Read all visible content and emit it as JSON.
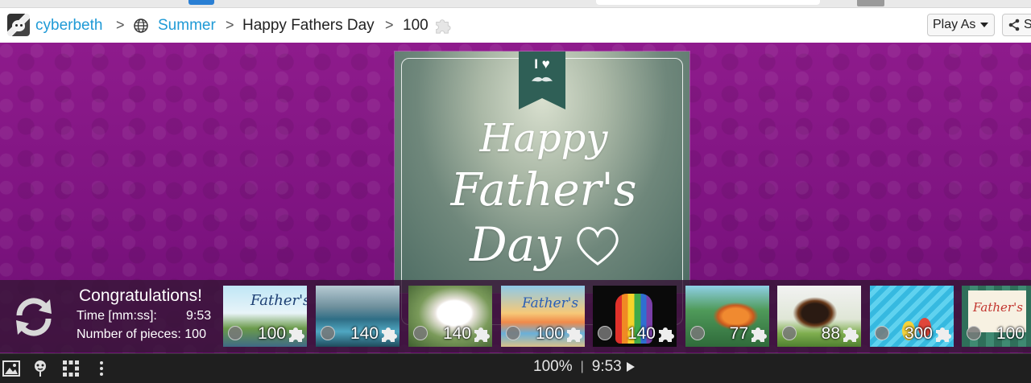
{
  "header": {
    "user": "cyberbeth",
    "category": "Summer",
    "puzzle_title": "Happy Fathers Day",
    "piece_count": "100",
    "play_as_label": "Play As",
    "share_label": "S"
  },
  "card": {
    "ribbon_text": "I ♥",
    "line1": "Happy",
    "line2": "Father's",
    "line3": "Day"
  },
  "completion": {
    "title": "Congratulations!",
    "time_label": "Time [mm:ss]:",
    "time_value": "9:53",
    "pieces_label": "Number of pieces: 100"
  },
  "thumbnails": [
    {
      "count": "100",
      "theme": "fathers-day-beach"
    },
    {
      "count": "140",
      "theme": "blue-lake"
    },
    {
      "count": "140",
      "theme": "white-dog"
    },
    {
      "count": "100",
      "theme": "fathers-day-sunset"
    },
    {
      "count": "140",
      "theme": "rainbow-fist"
    },
    {
      "count": "77",
      "theme": "bird-waterfall"
    },
    {
      "count": "88",
      "theme": "doberman"
    },
    {
      "count": "300",
      "theme": "pool-flipflops"
    },
    {
      "count": "100",
      "theme": "fathers-day-plaid"
    }
  ],
  "toolbar": {
    "zoom": "100%",
    "separator": "|",
    "timer": "9:53"
  },
  "colors": {
    "link": "#1f9ad6",
    "background": "#8e1b8c",
    "toolbar": "#1f1f1f"
  }
}
